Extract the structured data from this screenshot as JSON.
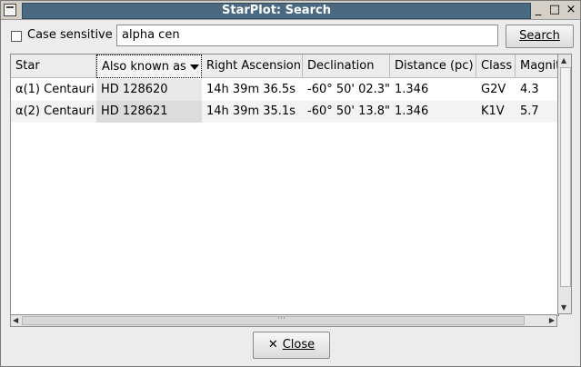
{
  "window": {
    "title": "StarPlot: Search",
    "controls": {
      "minimize": "_",
      "maximize": "□",
      "close": "×"
    }
  },
  "toolbar": {
    "case_sensitive_label": "Case sensitive",
    "case_sensitive_checked": false,
    "search_value": "alpha cen",
    "search_button": "Search"
  },
  "table": {
    "columns": [
      "Star",
      "Also known as",
      "Right Ascension",
      "Declination",
      "Distance (pc)",
      "Class",
      "Magnitude"
    ],
    "sorted_column": "Also known as",
    "rows": [
      [
        "α(1) Centauri",
        "HD 128620",
        "14h 39m 36.5s",
        "-60° 50' 02.3\"",
        "1.346",
        "G2V",
        "4.3"
      ],
      [
        "α(2) Centauri",
        "HD 128621",
        "14h 39m 35.1s",
        "-60° 50' 13.8\"",
        "1.346",
        "K1V",
        "5.7"
      ]
    ]
  },
  "footer": {
    "close_button": "Close"
  },
  "icons": [
    "system-menu-icon",
    "minimize-icon",
    "maximize-icon",
    "close-icon",
    "sort-desc-icon",
    "close-x-icon"
  ]
}
